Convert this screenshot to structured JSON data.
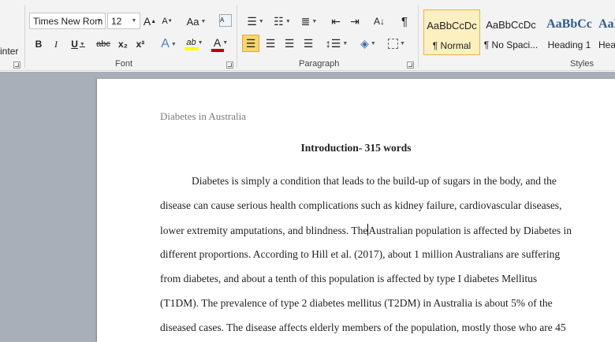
{
  "ribbon": {
    "clipboard": {
      "format_painter_label": "inter"
    },
    "font": {
      "group_label": "Font",
      "font_name": "Times New Rom",
      "font_size": "12",
      "grow_label": "A",
      "shrink_label": "A",
      "change_case_label": "Aa",
      "bold_label": "B",
      "italic_label": "I",
      "underline_label": "U",
      "strikethrough_label": "abc",
      "subscript_label": "x₂",
      "superscript_label": "x²",
      "text_effects_label": "A",
      "highlight_label": "ab",
      "font_color_label": "A",
      "highlight_color": "#ffff00",
      "font_color": "#c00000"
    },
    "paragraph": {
      "group_label": "Paragraph",
      "show_marks_label": "¶"
    },
    "styles": {
      "group_label": "Styles",
      "items": [
        {
          "sample": "AaBbCcDc",
          "name": "¶ Normal"
        },
        {
          "sample": "AaBbCcDc",
          "name": "¶ No Spaci..."
        },
        {
          "sample": "AaBbCc",
          "name": "Heading 1"
        },
        {
          "sample": "AaBbCc",
          "name": "Hea"
        }
      ]
    }
  },
  "document": {
    "header": "Diabetes in Australia",
    "heading": "Introduction- 315 words",
    "lines": [
      "Diabetes is simply a condition that leads to the build-up of sugars in the body, and the",
      "disease can cause serious health complications such as kidney failure, cardiovascular diseases,",
      "lower extremity amputations, and blindness. The",
      "Australian population is affected by Diabetes in",
      "different proportions. According to Hill et al. (2017), about 1 million Australians are suffering",
      "from diabetes, and about a tenth of this population is affected by type I diabetes Mellitus",
      "(T1DM). The prevalence of type 2 diabetes mellitus (T2DM) in Australia is about 5% of the",
      "diseased cases. The disease affects elderly members of the population, mostly those who are 45"
    ]
  }
}
